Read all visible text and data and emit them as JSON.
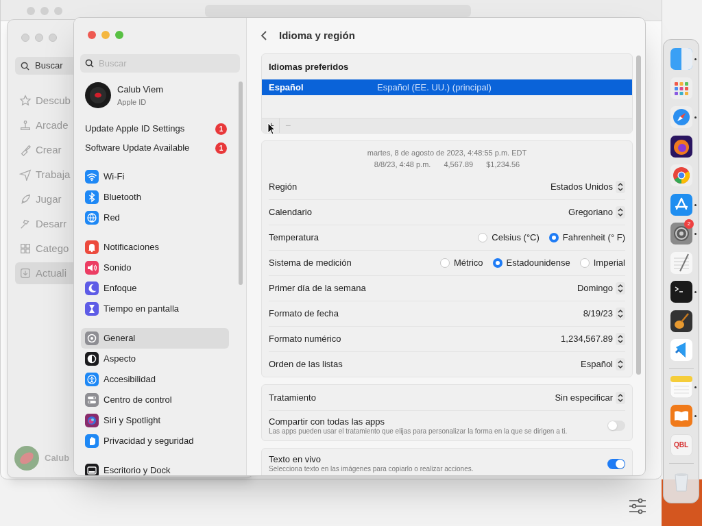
{
  "app_store": {
    "search": "Buscar",
    "sidebar": [
      {
        "label": "Descub",
        "selected": false
      },
      {
        "label": "Arcade",
        "selected": false
      },
      {
        "label": "Crear",
        "selected": false
      },
      {
        "label": "Trabaja",
        "selected": false
      },
      {
        "label": "Jugar",
        "selected": false
      },
      {
        "label": "Desarr",
        "selected": false
      },
      {
        "label": "Catego",
        "selected": false
      },
      {
        "label": "Actuali",
        "selected": true
      }
    ],
    "account": "Calub"
  },
  "settings": {
    "search": {
      "placeholder": "Buscar"
    },
    "account": {
      "name": "Calub Viem",
      "subtitle": "Apple ID"
    },
    "notices": [
      {
        "label": "Update Apple ID Settings",
        "badge": "1"
      },
      {
        "label": "Software Update Available",
        "badge": "1"
      }
    ],
    "sidebar_groups": [
      [
        {
          "label": "Wi-Fi",
          "color": "#1e88f5",
          "selected": false
        },
        {
          "label": "Bluetooth",
          "color": "#1e88f5",
          "selected": false
        },
        {
          "label": "Red",
          "color": "#1e88f5",
          "selected": false
        }
      ],
      [
        {
          "label": "Notificaciones",
          "color": "#ec4a3d",
          "selected": false
        },
        {
          "label": "Sonido",
          "color": "#ec3d63",
          "selected": false
        },
        {
          "label": "Enfoque",
          "color": "#5e5ce6",
          "selected": false
        },
        {
          "label": "Tiempo en pantalla",
          "color": "#5e5ce6",
          "selected": false
        }
      ],
      [
        {
          "label": "General",
          "color": "#8e8e93",
          "selected": true
        },
        {
          "label": "Aspecto",
          "color": "#1c1c1e",
          "selected": false
        },
        {
          "label": "Accesibilidad",
          "color": "#1e88f5",
          "selected": false
        },
        {
          "label": "Centro de control",
          "color": "#8e8e93",
          "selected": false
        },
        {
          "label": "Siri y Spotlight",
          "color": "#8a2b6b",
          "selected": false
        },
        {
          "label": "Privacidad y seguridad",
          "color": "#1e88f5",
          "selected": false
        }
      ],
      [
        {
          "label": "Escritorio y Dock",
          "color": "#1c1c1e",
          "selected": false
        }
      ]
    ],
    "page": {
      "title": "Idioma y región",
      "preferred_languages": {
        "title": "Idiomas preferidos",
        "rows": [
          {
            "language": "Español",
            "detail": "Español (EE. UU.) (principal)",
            "selected": true
          }
        ],
        "buttons": [
          {
            "label": "+",
            "disabled": false
          },
          {
            "label": "−",
            "disabled": true
          }
        ]
      },
      "preview": {
        "line_1": "martes, 8 de agosto de 2023, 4:48:55 p.m. EDT",
        "line_2": [
          "8/8/23, 4:48 p.m.",
          "4,567.89",
          "$1,234.56"
        ]
      },
      "groups": [
        [
          {
            "kind": "popup",
            "label": "Región",
            "value": "Estados Unidos"
          },
          {
            "kind": "popup",
            "label": "Calendario",
            "value": "Gregoriano"
          },
          {
            "kind": "radio",
            "label": "Temperatura",
            "options": [
              {
                "label": "Celsius (°C)",
                "selected": false
              },
              {
                "label": "Fahrenheit (° F)",
                "selected": true
              }
            ]
          },
          {
            "kind": "radio",
            "label": "Sistema de medición",
            "options": [
              {
                "label": "Métrico",
                "selected": false
              },
              {
                "label": "Estadounidense",
                "selected": true
              },
              {
                "label": "Imperial",
                "selected": false
              }
            ]
          },
          {
            "kind": "popup",
            "label": "Primer día de la semana",
            "value": "Domingo"
          },
          {
            "kind": "popup",
            "label": "Formato de fecha",
            "value": "8/19/23"
          },
          {
            "kind": "popup",
            "label": "Formato numérico",
            "value": "1,234,567.89"
          },
          {
            "kind": "popup",
            "label": "Orden de las listas",
            "value": "Español"
          }
        ],
        [
          {
            "kind": "popup",
            "label": "Tratamiento",
            "value": "Sin especificar"
          },
          {
            "kind": "toggle",
            "label": "Compartir con todas las apps",
            "description": "Las apps pueden usar el tratamiento que elijas para personalizar la forma en la que se dirigen a ti.",
            "on": false
          }
        ],
        [
          {
            "kind": "toggle",
            "label": "Texto en vivo",
            "description": "Selecciona texto en las imágenes para copiarlo o realizar acciones.",
            "on": true
          }
        ]
      ]
    }
  },
  "dock": {
    "sections": [
      [
        {
          "running": true
        },
        {
          "running": false
        },
        {
          "running": true
        },
        {
          "running": false
        },
        {
          "running": false
        },
        {
          "running": true
        },
        {
          "running": true,
          "badge": "2"
        },
        {
          "running": false
        },
        {
          "running": true
        },
        {
          "running": false
        },
        {
          "running": false
        }
      ],
      [
        {
          "running": true
        },
        {
          "running": true
        },
        {
          "running": false,
          "text": "QBL"
        }
      ],
      [
        {
          "running": false
        }
      ]
    ]
  }
}
